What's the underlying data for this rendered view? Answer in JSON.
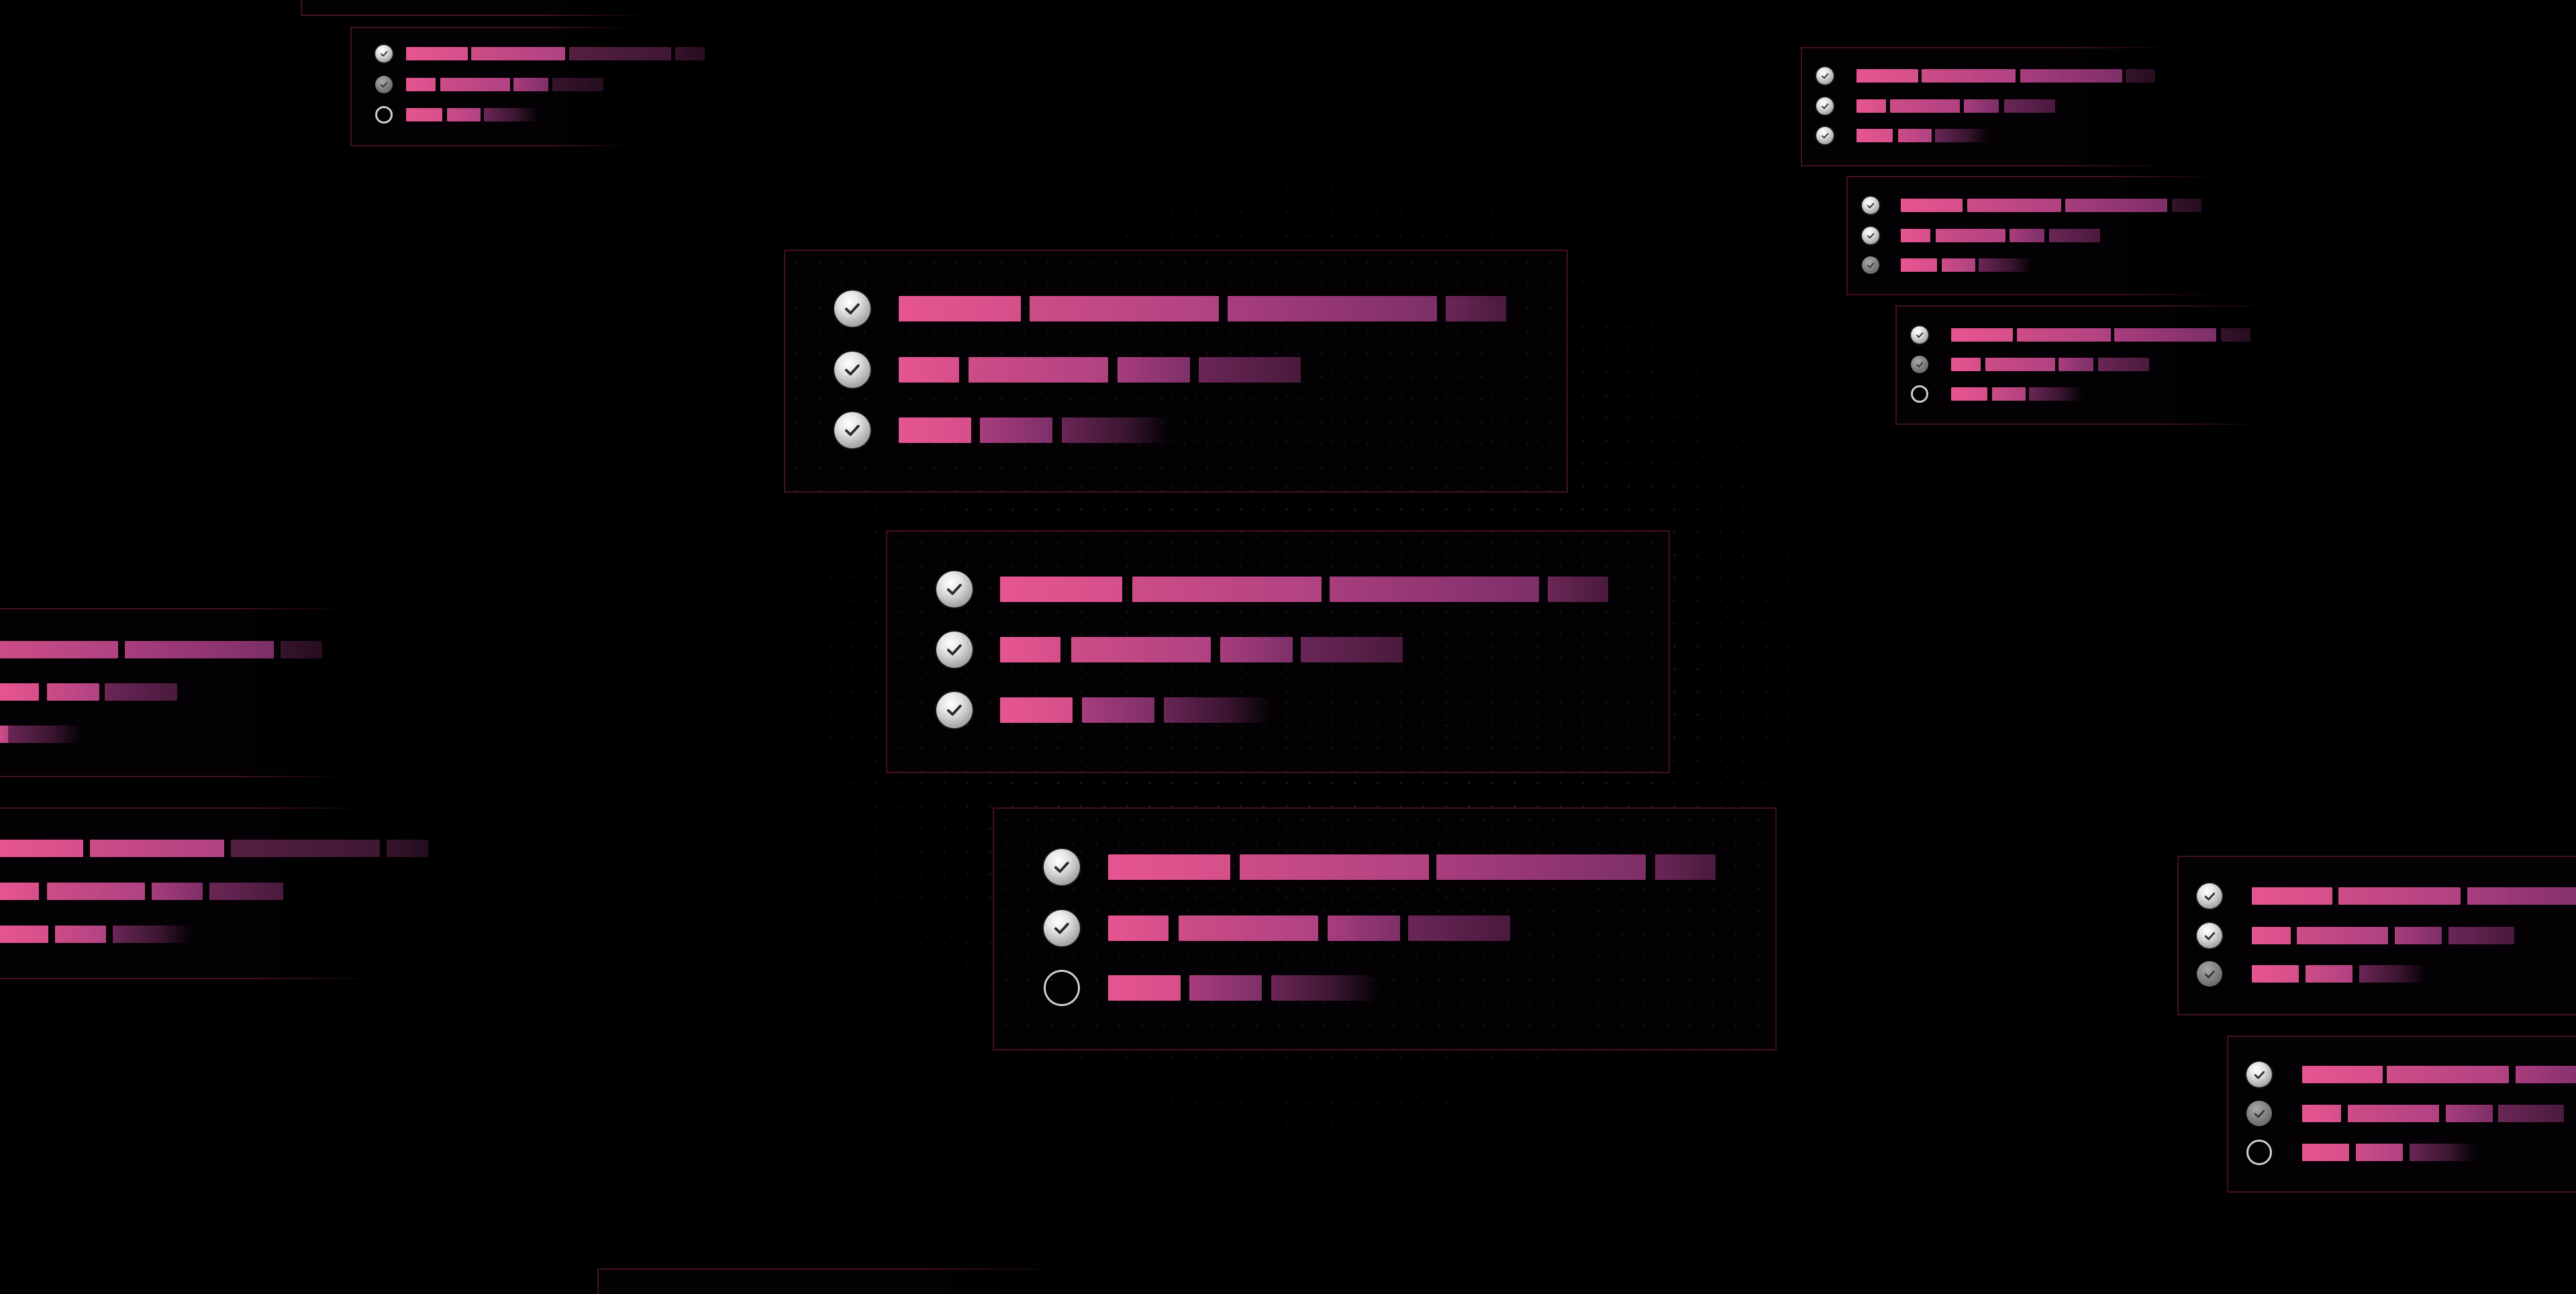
{
  "colors": {
    "background": "#000000",
    "card_border": "#43111f",
    "bar_primary": "#e65590",
    "bar_secondary": "#b04282",
    "bar_tertiary": "#7d2f68",
    "bar_dim": "#4a1a3d",
    "check_fill": "#e6e6e6"
  },
  "icons": {
    "done": "checkmark-circle-icon",
    "half": "grey-checkmark-circle-icon",
    "todo": "empty-circle-icon"
  },
  "cards": [
    {
      "id": "top-left-small",
      "states": [
        "done",
        "half",
        "todo"
      ]
    },
    {
      "id": "top-right-1",
      "states": [
        "done",
        "done",
        "done"
      ]
    },
    {
      "id": "top-right-2",
      "states": [
        "done",
        "done",
        "half"
      ]
    },
    {
      "id": "top-right-3",
      "states": [
        "done",
        "half",
        "todo"
      ]
    },
    {
      "id": "center-1",
      "states": [
        "done",
        "done",
        "done"
      ]
    },
    {
      "id": "center-2",
      "states": [
        "done",
        "done",
        "done"
      ]
    },
    {
      "id": "center-3",
      "states": [
        "done",
        "done",
        "todo"
      ]
    },
    {
      "id": "left-1",
      "states": [
        "none",
        "none",
        "none"
      ]
    },
    {
      "id": "left-2",
      "states": [
        "none",
        "none",
        "none"
      ]
    },
    {
      "id": "right-1",
      "states": [
        "done",
        "done",
        "half"
      ]
    },
    {
      "id": "right-2",
      "states": [
        "done",
        "half",
        "todo"
      ]
    }
  ]
}
